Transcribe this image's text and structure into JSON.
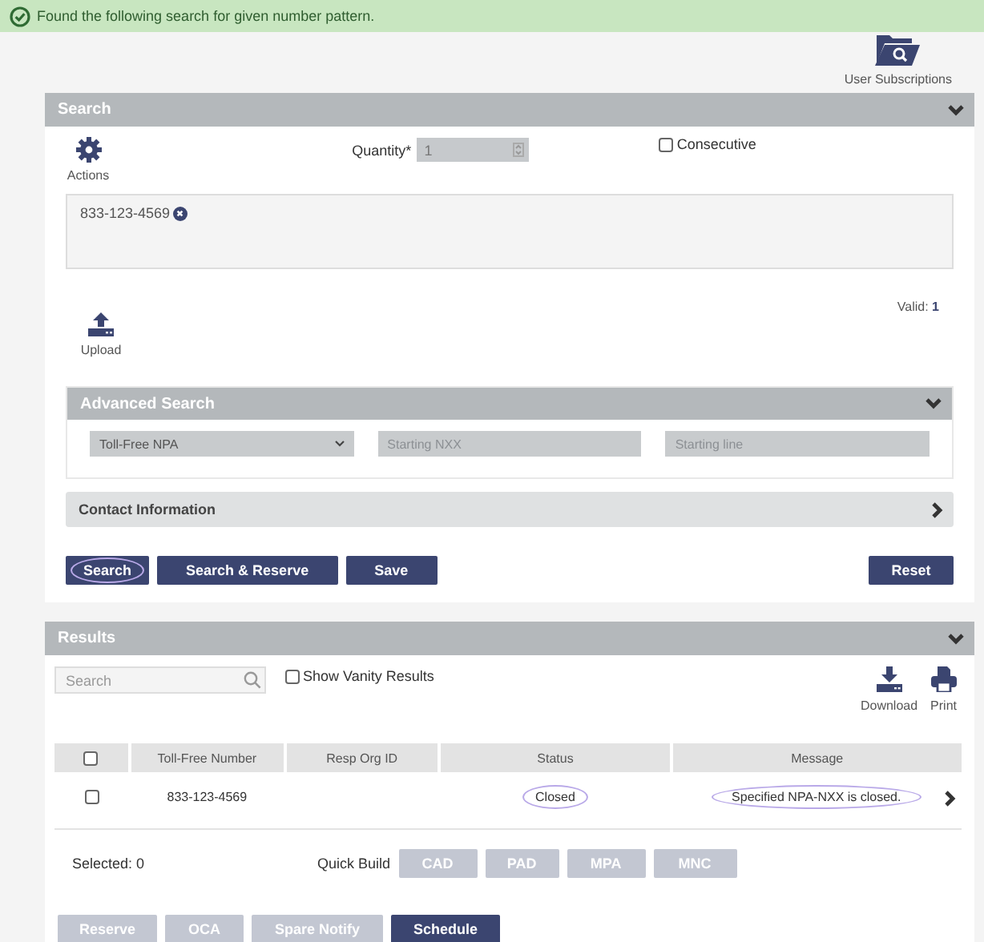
{
  "banner": {
    "message": "Found the following search for given number pattern."
  },
  "subscriptions": {
    "label": "User Subscriptions"
  },
  "search_panel": {
    "title": "Search",
    "expanded": true,
    "actions_label": "Actions",
    "quantity": {
      "label": "Quantity*",
      "value": "1",
      "disabled": true
    },
    "consecutive": {
      "label": "Consecutive",
      "checked": false
    },
    "numbers": [
      {
        "text": "833-123-4569"
      }
    ],
    "upload_label": "Upload",
    "valid": {
      "label": "Valid:",
      "count": "1"
    },
    "advanced": {
      "title": "Advanced Search",
      "expanded": true,
      "select": "Toll-Free NPA",
      "fields": [
        {
          "placeholder": "Starting NXX"
        },
        {
          "placeholder": "Starting line"
        }
      ]
    },
    "contact": {
      "title": "Contact Information",
      "expanded": false
    },
    "buttons": [
      {
        "label": "Search",
        "circled": true
      },
      {
        "label": "Search & Reserve",
        "circled": false
      },
      {
        "label": "Save",
        "circled": false
      }
    ],
    "reset": "Reset"
  },
  "results_panel": {
    "title": "Results",
    "expanded": true,
    "search_placeholder": "Search",
    "vanity": {
      "label": "Show Vanity Results",
      "checked": false
    },
    "tools": [
      {
        "label": "Download",
        "kind": "download"
      },
      {
        "label": "Print",
        "kind": "print"
      }
    ],
    "table": {
      "select_all": false,
      "columns": [
        "Toll-Free Number",
        "Resp Org ID",
        "Status",
        "Message"
      ],
      "rows": [
        {
          "checked": false,
          "number": "833-123-4569",
          "status": {
            "text": "Closed",
            "circled": true
          },
          "message": {
            "text": "Specified NPA-NXX is closed.",
            "circled": true
          }
        }
      ]
    },
    "selected": "Selected: 0",
    "quick_build": {
      "label": "Quick Build",
      "buttons": [
        {
          "label": "CAD",
          "disabled": true
        },
        {
          "label": "PAD",
          "disabled": true
        },
        {
          "label": "MPA",
          "disabled": true
        },
        {
          "label": "MNC",
          "disabled": true
        }
      ]
    },
    "actions": [
      {
        "label": "Reserve",
        "disabled": true
      },
      {
        "label": "OCA",
        "disabled": true
      },
      {
        "label": "Spare Notify",
        "disabled": true
      },
      {
        "label": "Schedule",
        "disabled": false
      }
    ]
  }
}
